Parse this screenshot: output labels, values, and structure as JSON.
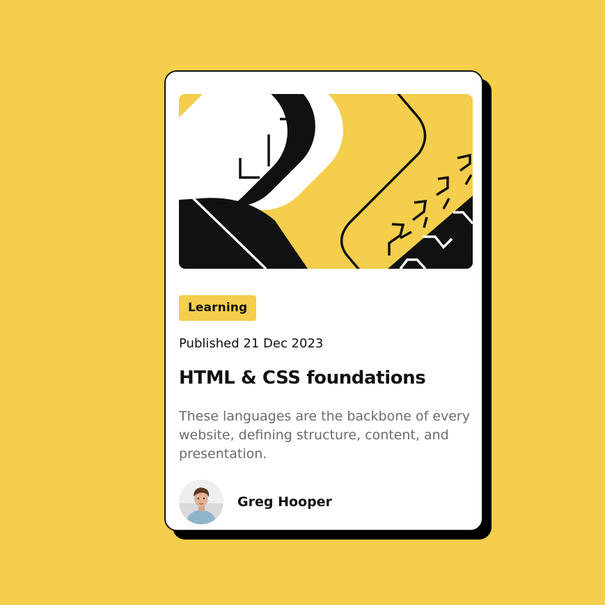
{
  "colors": {
    "page_background": "#F4CE4C",
    "card_background": "#FFFFFF",
    "ink": "#111111",
    "muted_text": "#6B6B6B",
    "badge_background": "#F4CE4C"
  },
  "card": {
    "hero_image": "abstract-illustration",
    "badge_label": "Learning",
    "published": "Published 21 Dec 2023",
    "title": "HTML & CSS foundations",
    "description": "These languages are the backbone of every website, defining structure, content, and presentation.",
    "author": {
      "name": "Greg Hooper",
      "avatar": "author-avatar"
    }
  }
}
